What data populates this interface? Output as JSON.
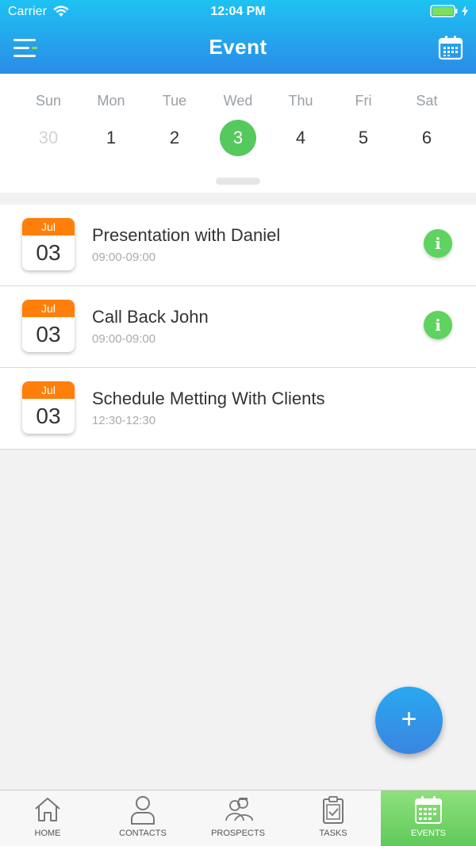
{
  "status_bar": {
    "carrier": "Carrier",
    "time": "12:04 PM"
  },
  "nav": {
    "title": "Event",
    "menu_icon": "menu-icon",
    "calendar_icon": "calendar-icon"
  },
  "week": {
    "days": [
      {
        "name": "Sun",
        "num": "30",
        "state": "muted"
      },
      {
        "name": "Mon",
        "num": "1",
        "state": "normal"
      },
      {
        "name": "Tue",
        "num": "2",
        "state": "normal"
      },
      {
        "name": "Wed",
        "num": "3",
        "state": "selected"
      },
      {
        "name": "Thu",
        "num": "4",
        "state": "normal"
      },
      {
        "name": "Fri",
        "num": "5",
        "state": "normal"
      },
      {
        "name": "Sat",
        "num": "6",
        "state": "normal"
      }
    ]
  },
  "events": [
    {
      "month": "Jul",
      "day": "03",
      "title": "Presentation with Daniel",
      "time": "09:00-09:00",
      "has_info": true
    },
    {
      "month": "Jul",
      "day": "03",
      "title": "Call Back John",
      "time": "09:00-09:00",
      "has_info": true
    },
    {
      "month": "Jul",
      "day": "03",
      "title": "Schedule Metting With Clients",
      "time": "12:30-12:30",
      "has_info": false
    }
  ],
  "fab": {
    "label": "+"
  },
  "tabs": [
    {
      "label": "HOME",
      "icon": "home-icon",
      "active": false
    },
    {
      "label": "CONTACTS",
      "icon": "contacts-icon",
      "active": false
    },
    {
      "label": "PROSPECTS",
      "icon": "prospects-icon",
      "active": false
    },
    {
      "label": "TASKS",
      "icon": "tasks-icon",
      "active": false
    },
    {
      "label": "EVENTS",
      "icon": "events-icon",
      "active": true
    }
  ],
  "colors": {
    "header_top": "#1ec2f3",
    "header_bottom": "#2a8ce6",
    "selected_day": "#55c95d",
    "badge_month": "#ff7f0a",
    "info": "#5ed35f",
    "active_tab": "#6fd066"
  }
}
